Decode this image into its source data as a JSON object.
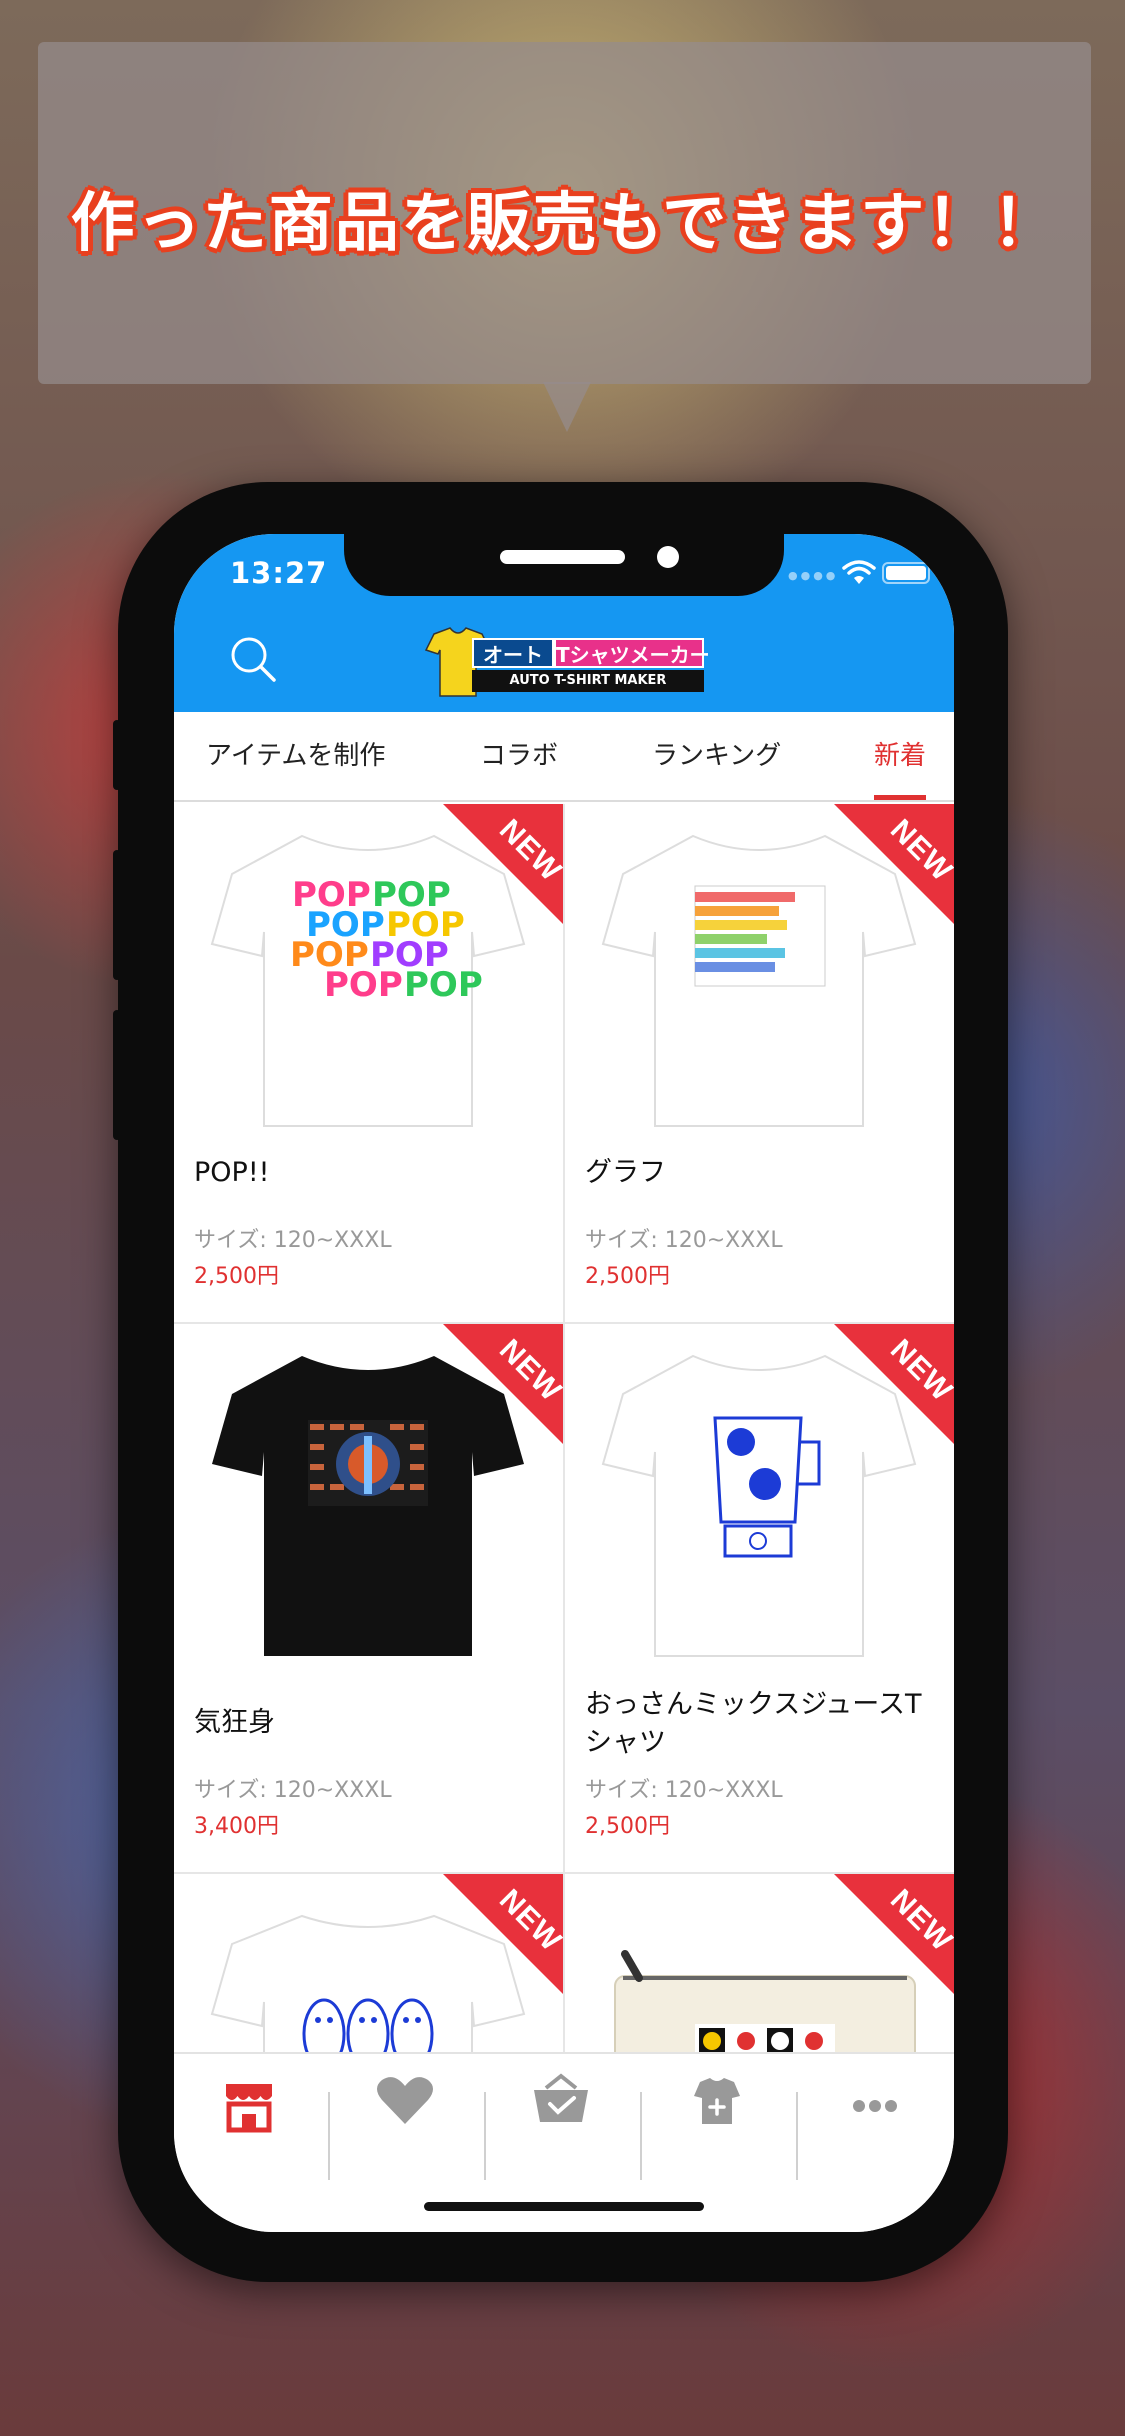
{
  "banner": {
    "text": "作った商品を販売もできます！！"
  },
  "status": {
    "time": "13:27"
  },
  "header": {
    "logo_left": "オート",
    "logo_right": "Tシャツメーカー",
    "logo_sub": "AUTO T-SHIRT MAKER"
  },
  "tabs": [
    {
      "label": "アイテムを制作"
    },
    {
      "label": "コラボ"
    },
    {
      "label": "ランキング"
    },
    {
      "label": "新着",
      "active": true
    }
  ],
  "badge": "NEW",
  "products": [
    {
      "title": "POP!!",
      "size": "サイズ: 120~XXXL",
      "price": "2,500円",
      "shirt_color": "#ffffff",
      "art": "POP POP"
    },
    {
      "title": "グラフ",
      "size": "サイズ: 120~XXXL",
      "price": "2,500円",
      "shirt_color": "#ffffff",
      "art": "graph"
    },
    {
      "title": "気狂身",
      "size": "サイズ: 120~XXXL",
      "price": "3,400円",
      "shirt_color": "#111111",
      "art": "pattern"
    },
    {
      "title": "おっさんミックスジュースTシャツ",
      "size": "サイズ: 120~XXXL",
      "price": "2,500円",
      "shirt_color": "#ffffff",
      "art": "blender"
    },
    {
      "title": "",
      "size": "",
      "price": "",
      "shirt_color": "#ffffff",
      "art": "penguins"
    },
    {
      "title": "",
      "size": "",
      "price": "",
      "shirt_color": "#f3eee0",
      "art": "pouch"
    }
  ],
  "bottom_nav": [
    {
      "icon": "shop-icon",
      "active": true
    },
    {
      "icon": "heart-icon"
    },
    {
      "icon": "basket-icon"
    },
    {
      "icon": "tshirt-plus-icon"
    },
    {
      "icon": "more-icon"
    }
  ],
  "colors": {
    "accent": "#1597f2",
    "red": "#e03131"
  }
}
